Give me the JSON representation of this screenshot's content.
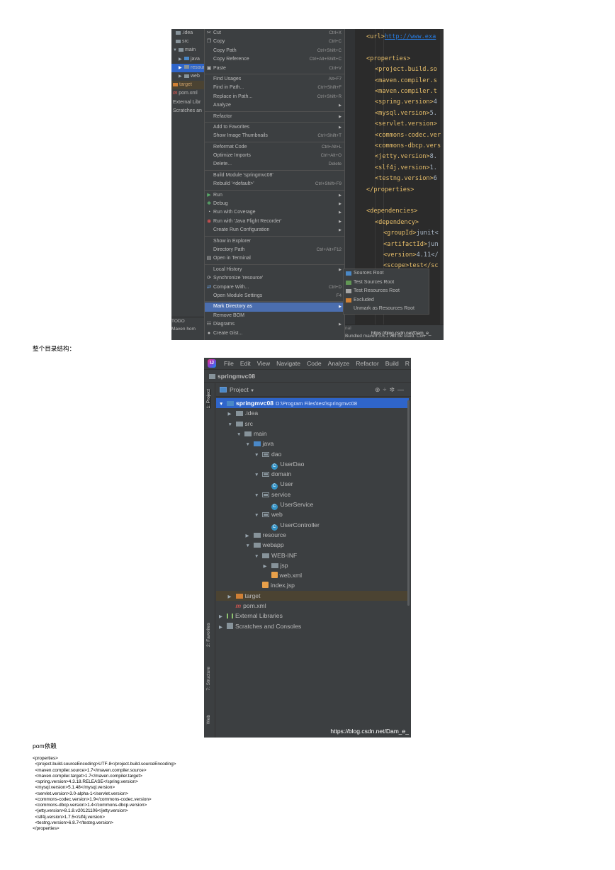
{
  "screenshot1": {
    "tree": {
      "items": [
        ".idea",
        "src",
        "main",
        "java",
        "resource",
        "web",
        "target",
        "pom.xml",
        "External Libr",
        "Scratches an"
      ],
      "bottom": [
        "TODO",
        "Maven hom"
      ]
    },
    "menu": [
      {
        "label": "Cut",
        "shortcut": "Ctrl+X",
        "icon": "scissors-icon"
      },
      {
        "label": "Copy",
        "shortcut": "Ctrl+C",
        "icon": "copy-icon"
      },
      {
        "label": "Copy Path",
        "shortcut": "Ctrl+Shift+C"
      },
      {
        "label": "Copy Reference",
        "shortcut": "Ctrl+Alt+Shift+C"
      },
      {
        "label": "Paste",
        "shortcut": "Ctrl+V",
        "icon": "paste-icon"
      },
      {
        "label": "Find Usages",
        "shortcut": "Alt+F7"
      },
      {
        "label": "Find in Path...",
        "shortcut": "Ctrl+Shift+F"
      },
      {
        "label": "Replace in Path...",
        "shortcut": "Ctrl+Shift+R"
      },
      {
        "label": "Analyze",
        "submenu": true
      },
      {
        "label": "Refactor",
        "submenu": true
      },
      {
        "label": "Add to Favorites",
        "submenu": true
      },
      {
        "label": "Show Image Thumbnails",
        "shortcut": "Ctrl+Shift+T"
      },
      {
        "label": "Reformat Code",
        "shortcut": "Ctrl+Alt+L"
      },
      {
        "label": "Optimize Imports",
        "shortcut": "Ctrl+Alt+O"
      },
      {
        "label": "Delete...",
        "shortcut": "Delete"
      },
      {
        "label": "Build Module 'springmvc08'"
      },
      {
        "label": "Rebuild '<default>'",
        "shortcut": "Ctrl+Shift+F9"
      },
      {
        "label": "Run",
        "submenu": true,
        "icon": "run-icon"
      },
      {
        "label": "Debug",
        "submenu": true,
        "icon": "debug-icon"
      },
      {
        "label": "Run with Coverage",
        "submenu": true,
        "icon": "coverage-icon"
      },
      {
        "label": "Run with 'Java Flight Recorder'",
        "submenu": true,
        "icon": "flight-recorder-icon"
      },
      {
        "label": "Create Run Configuration",
        "submenu": true
      },
      {
        "label": "Show in Explorer"
      },
      {
        "label": "Directory Path",
        "shortcut": "Ctrl+Alt+F12"
      },
      {
        "label": "Open in Terminal",
        "icon": "terminal-icon"
      },
      {
        "label": "Local History",
        "submenu": true
      },
      {
        "label": "Synchronize 'resource'",
        "icon": "sync-icon"
      },
      {
        "label": "Compare With...",
        "shortcut": "Ctrl+D",
        "icon": "compare-icon"
      },
      {
        "label": "Open Module Settings",
        "shortcut": "F4"
      },
      {
        "label": "Mark Directory as",
        "submenu": true,
        "highlighted": true
      },
      {
        "label": "Remove BOM"
      },
      {
        "label": "Diagrams",
        "submenu": true,
        "icon": "diagram-icon"
      },
      {
        "label": "Create Gist...",
        "icon": "github-icon"
      }
    ],
    "submenu": [
      {
        "label": "Sources Root",
        "color": "#4a88c7"
      },
      {
        "label": "Test Sources Root",
        "color": "#629755"
      },
      {
        "label": "Test Resources Root",
        "color": "#a5a5a5"
      },
      {
        "label": "Excluded",
        "color": "#d08035"
      },
      {
        "label": "Unmark as Resources Root",
        "color": ""
      }
    ],
    "editor": {
      "lines": [
        {
          "tag": "<url>",
          "text": "http://www.exa",
          "url": true,
          "indent": 0
        },
        {
          "tag": "",
          "text": "",
          "indent": 0
        },
        {
          "tag": "<properties>",
          "text": "",
          "indent": 0
        },
        {
          "tag": "<project.build.so",
          "text": "",
          "indent": 1
        },
        {
          "tag": "<maven.compiler.s",
          "text": "",
          "indent": 1
        },
        {
          "tag": "<maven.compiler.t",
          "text": "",
          "indent": 1
        },
        {
          "tag": "<spring.version>",
          "text": "4",
          "indent": 1
        },
        {
          "tag": "<mysql.version>",
          "text": "5.",
          "indent": 1
        },
        {
          "tag": "<servlet.version>",
          "text": "",
          "indent": 1
        },
        {
          "tag": "<commons-codec.ver",
          "text": "",
          "indent": 1
        },
        {
          "tag": "<commons-dbcp.vers",
          "text": "",
          "indent": 1
        },
        {
          "tag": "<jetty.version>",
          "text": "8.",
          "indent": 1
        },
        {
          "tag": "<slf4j.version>",
          "text": "1.",
          "indent": 1
        },
        {
          "tag": "<testng.version>",
          "text": "6",
          "indent": 1
        },
        {
          "tag": "</properties>",
          "text": "",
          "indent": 0
        },
        {
          "tag": "",
          "text": "",
          "indent": 0
        },
        {
          "tag": "<dependencies>",
          "text": "",
          "indent": 0
        },
        {
          "tag": "<dependency>",
          "text": "",
          "indent": 1
        },
        {
          "tag": "<groupId>",
          "text": "junit<",
          "indent": 2
        },
        {
          "tag": "<artifactId>",
          "text": "jun",
          "indent": 2
        },
        {
          "tag": "<version>",
          "text": "4.11</",
          "indent": 2
        },
        {
          "tag": "<scope>test</sc",
          "text": "",
          "indent": 2
        }
      ]
    },
    "status": {
      "line1": "nal",
      "line2": "Bundled maven 3.6.1 will be used.  Con",
      "watermark": "https://blog.csdn.net/Dam_e_"
    }
  },
  "heading_structure": "整个目录结构：",
  "screenshot2": {
    "menubar": [
      "File",
      "Edit",
      "View",
      "Navigate",
      "Code",
      "Analyze",
      "Refactor",
      "Build",
      "R"
    ],
    "breadcrumb": "springmvc08",
    "panel_title": "Project",
    "side_tabs": [
      "1: Project",
      "2: Favorites",
      "7: Structure",
      "Web"
    ],
    "tree": [
      {
        "label": "springmvc08",
        "path": "D:\\Program Files\\test\\springmvc08",
        "depth": 0,
        "arrow": "▼",
        "icon": "module",
        "selected": true
      },
      {
        "label": ".idea",
        "depth": 1,
        "arrow": "▶",
        "icon": "folder"
      },
      {
        "label": "src",
        "depth": 1,
        "arrow": "▼",
        "icon": "folder"
      },
      {
        "label": "main",
        "depth": 2,
        "arrow": "▼",
        "icon": "folder"
      },
      {
        "label": "java",
        "depth": 3,
        "arrow": "▼",
        "icon": "folder-blue"
      },
      {
        "label": "dao",
        "depth": 4,
        "arrow": "▼",
        "icon": "package"
      },
      {
        "label": "UserDao",
        "depth": 5,
        "arrow": "",
        "icon": "class"
      },
      {
        "label": "domain",
        "depth": 4,
        "arrow": "▼",
        "icon": "package"
      },
      {
        "label": "User",
        "depth": 5,
        "arrow": "",
        "icon": "class"
      },
      {
        "label": "service",
        "depth": 4,
        "arrow": "▼",
        "icon": "package"
      },
      {
        "label": "UserService",
        "depth": 5,
        "arrow": "",
        "icon": "class"
      },
      {
        "label": "web",
        "depth": 4,
        "arrow": "▼",
        "icon": "package"
      },
      {
        "label": "UserController",
        "depth": 5,
        "arrow": "",
        "icon": "class"
      },
      {
        "label": "resource",
        "depth": 3,
        "arrow": "▶",
        "icon": "folder-res"
      },
      {
        "label": "webapp",
        "depth": 3,
        "arrow": "▼",
        "icon": "folder-web"
      },
      {
        "label": "WEB-INF",
        "depth": 4,
        "arrow": "▼",
        "icon": "folder"
      },
      {
        "label": "jsp",
        "depth": 5,
        "arrow": "▶",
        "icon": "folder"
      },
      {
        "label": "web.xml",
        "depth": 5,
        "arrow": "",
        "icon": "xml"
      },
      {
        "label": "index.jsp",
        "depth": 4,
        "arrow": "",
        "icon": "jsp"
      },
      {
        "label": "target",
        "depth": 1,
        "arrow": "▶",
        "icon": "folder-orange",
        "target": true
      },
      {
        "label": "pom.xml",
        "depth": 1,
        "arrow": "",
        "icon": "maven"
      },
      {
        "label": "External Libraries",
        "depth": 0,
        "arrow": "▶",
        "icon": "library"
      },
      {
        "label": "Scratches and Consoles",
        "depth": 0,
        "arrow": "▶",
        "icon": "scratch"
      }
    ],
    "watermark": "https://blog.csdn.net/Dam_e_"
  },
  "heading_pom": "pom依赖",
  "pom_lines": [
    "<properties>",
    "  <project.build.sourceEncoding>UTF-8</project.build.sourceEncoding>",
    "  <maven.compiler.source>1.7</maven.compiler.source>",
    "  <maven.compiler.target>1.7</maven.compiler.target>",
    "  <spring.version>4.3.18.RELEASE</spring.version>",
    "  <mysql.version>5.1.48</mysql.version>",
    "  <servlet.version>3.0-alpha-1</servlet.version>",
    "  <commons-codec.version>1.9</commons-codec.version>",
    "  <commons-dbcp.version>1.4</commons-dbcp.version>",
    "  <jetty.version>8.1.8.v20121106</jetty.version>",
    "  <slf4j.version>1.7.5</slf4j.version>",
    "  <testng.version>6.8.7</testng.version>",
    "</properties>"
  ]
}
